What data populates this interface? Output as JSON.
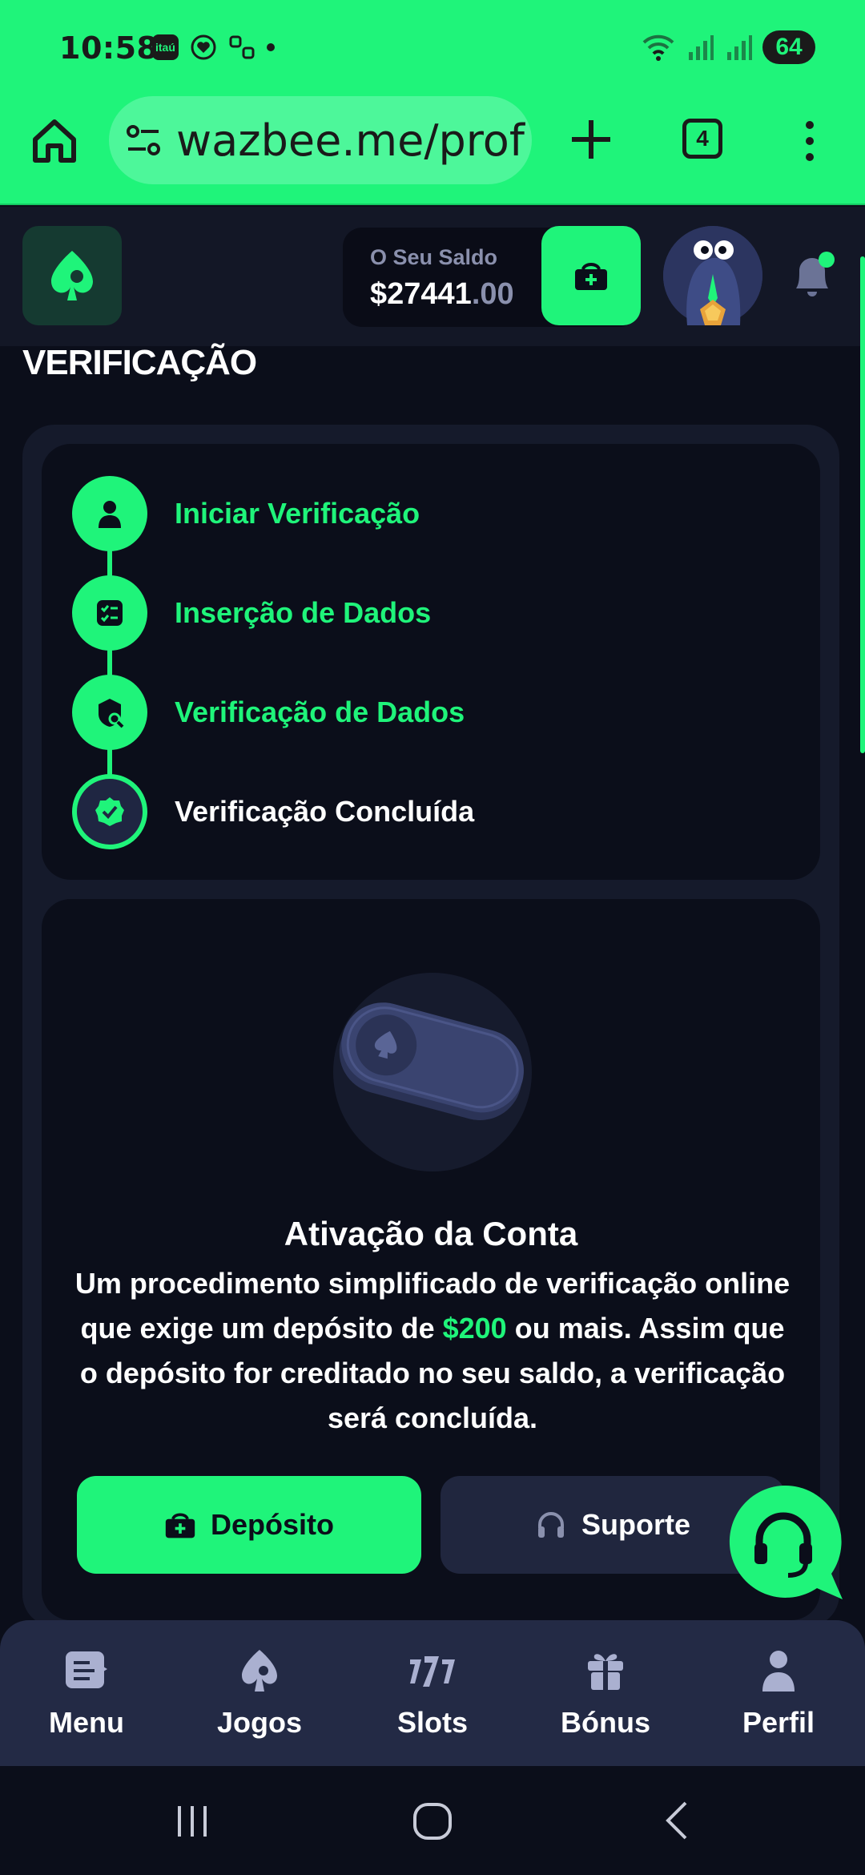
{
  "status_bar": {
    "time": "10:58",
    "app_badge": "itaú",
    "battery": "64"
  },
  "browser": {
    "url": "wazbee.me/prof",
    "tab_count": "4"
  },
  "header": {
    "balance_label": "O Seu Saldo",
    "balance_whole": "$27441",
    "balance_cents": ".00"
  },
  "page": {
    "title": "VERIFICAÇÃO"
  },
  "steps": [
    {
      "label": "Iniciar Verificação",
      "icon": "user-icon",
      "status": "complete"
    },
    {
      "label": "Inserção de Dados",
      "icon": "checklist-icon",
      "status": "complete"
    },
    {
      "label": "Verificação de Dados",
      "icon": "shield-search-icon",
      "status": "complete"
    },
    {
      "label": "Verificação Concluída",
      "icon": "verified-badge-icon",
      "status": "current"
    }
  ],
  "activation": {
    "title": "Ativação da Conta",
    "desc_part1": "Um procedimento simplificado de verificação online que exige um depósito de ",
    "desc_amount": "$200",
    "desc_part2": " ou mais. Assim que o depósito for creditado no seu saldo, a verificação será concluída.",
    "deposit_label": "Depósito",
    "support_label": "Suporte"
  },
  "bottom_nav": [
    {
      "label": "Menu",
      "icon": "menu-icon"
    },
    {
      "label": "Jogos",
      "icon": "spade-icon"
    },
    {
      "label": "Slots",
      "icon": "slots-777-icon"
    },
    {
      "label": "Bónus",
      "icon": "gift-icon"
    },
    {
      "label": "Perfil",
      "icon": "profile-icon"
    }
  ],
  "colors": {
    "accent": "#1ff47a",
    "background": "#0b0e1a",
    "panel": "#151a2b",
    "nav": "#232a45",
    "muted": "#8a90ad"
  }
}
